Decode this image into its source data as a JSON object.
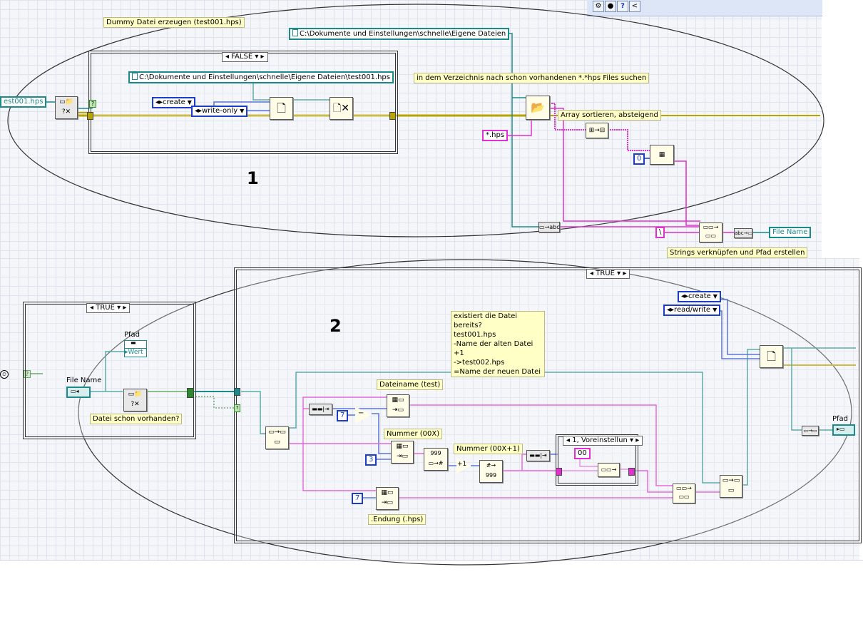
{
  "toolbar": {
    "buttons": [
      {
        "icon": "gear-icon",
        "glyph": "⚙"
      },
      {
        "icon": "lock-icon",
        "glyph": "🔒"
      },
      {
        "icon": "help-icon",
        "glyph": "?"
      },
      {
        "icon": "chevron-left-icon",
        "glyph": "<"
      }
    ]
  },
  "section1": {
    "number": "1",
    "comment_dummy": "Dummy Datei erzeugen (test001.hps)",
    "case_selector": "FALSE",
    "path_const_top": "C:\\Dokumente und Einstellungen\\schnelle\\Eigene Dateien",
    "path_const_case": "C:\\Dokumente und Einstellungen\\schnelle\\Eigene Dateien\\test001.hps",
    "enum_create": "create",
    "enum_write_only": "write-only",
    "left_terminal": "est001.hps",
    "comment_search": "in dem Verzeichnis nach schon vorhandenen *.*hps Files suchen",
    "pattern_const": "*.hps",
    "comment_sort": "Array sortieren, absteigend",
    "index_const": "0",
    "backslash_const": "\\",
    "indicator_filename": "File Name",
    "comment_concat": "Strings verknüpfen und Pfad erstellen"
  },
  "section2": {
    "number": "2",
    "left_case_selector": "TRUE",
    "pfad_label": "Pfad",
    "wert_label": "Wert",
    "file_name_label": "File Name",
    "comment_exists": "Datei schon vorhanden?",
    "case_selector": "TRUE",
    "enum_create": "create",
    "enum_read_write": "read/write",
    "comment_info": "existiert die Datei bereits?\ntest001.hps\n-Name der alten Datei +1\n->test002.hps\n=Name der neuen Datei",
    "label_dateiname": "Dateiname (test)",
    "label_nummer": "Nummer (00X)",
    "label_nummer_plus": "Nummer (00X+1)",
    "label_endung": ".Endung (.hps)",
    "const_7a": "7",
    "const_3": "3",
    "const_7b": "7",
    "const_00": "00",
    "inner_case_selector": "1, Voreinstellun",
    "pfad_out_label": "Pfad"
  },
  "colors": {
    "wire_string": "#e030d0",
    "wire_path": "#1c8a8a",
    "wire_refnum": "#1c8a8a",
    "wire_error": "#b8a400",
    "wire_enum": "#1a3ec8",
    "wire_bool": "#2c8a2c",
    "comment_bg": "#ffffc6",
    "grid_bg": "#f4f6fa"
  }
}
